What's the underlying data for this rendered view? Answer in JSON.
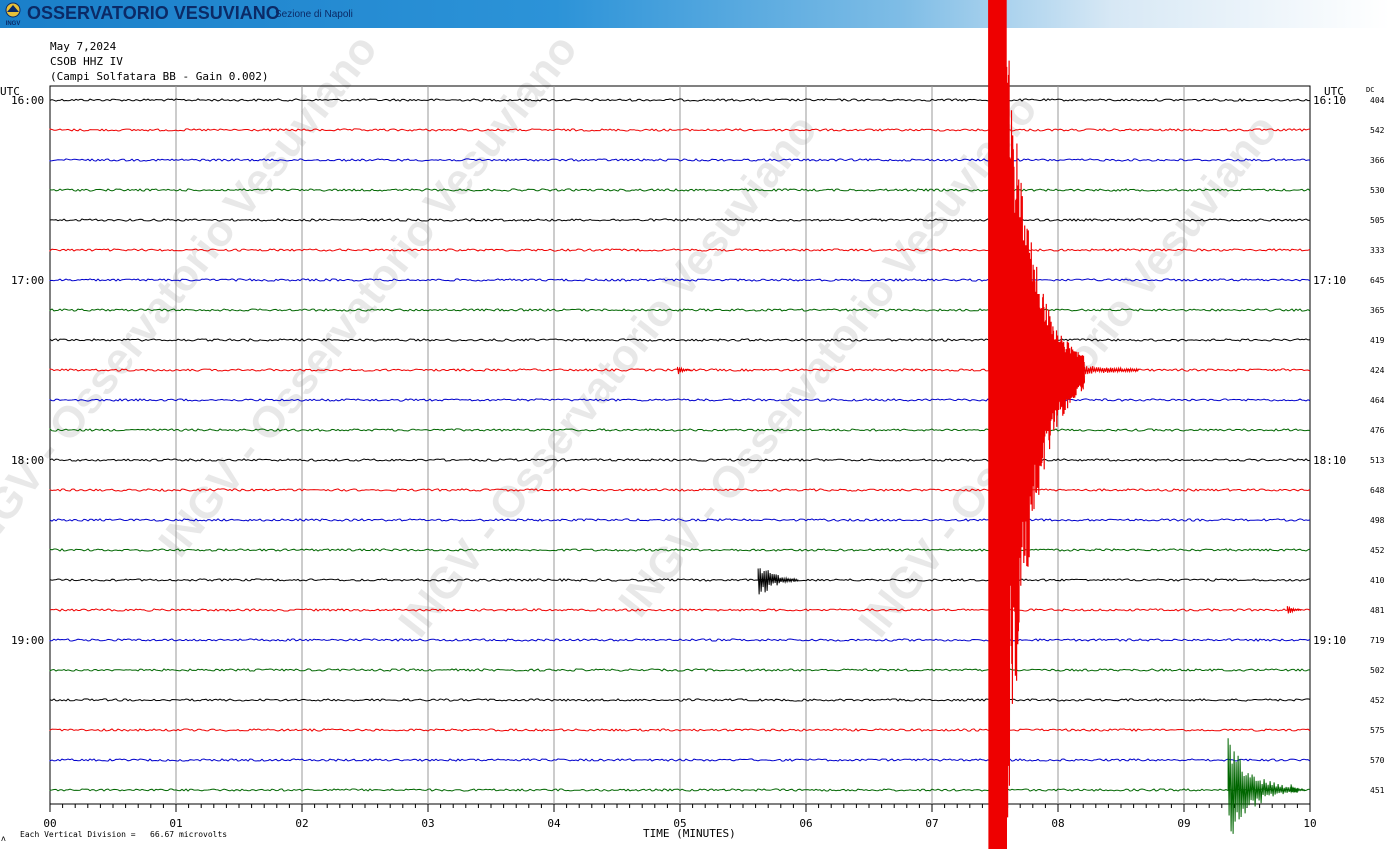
{
  "banner": {
    "title": "OSSERVATORIO VESUVIANO",
    "section": "Sezione di Napoli",
    "logo_text": "INGV"
  },
  "header": {
    "date": "May 7,2024",
    "station": "CSOB HHZ IV",
    "description": "(Campi Solfatara BB - Gain 0.002)"
  },
  "axes": {
    "left_unit": "UTC",
    "right_unit": "UTC",
    "dc_label": "DC",
    "xlabel": "TIME (MINUTES)",
    "x_ticks": [
      "00",
      "01",
      "02",
      "03",
      "04",
      "05",
      "06",
      "07",
      "08",
      "09",
      "10"
    ],
    "left_time_labels": [
      {
        "row": 0,
        "text": "16:00"
      },
      {
        "row": 6,
        "text": "17:00"
      },
      {
        "row": 12,
        "text": "18:00"
      },
      {
        "row": 18,
        "text": "19:00"
      }
    ],
    "right_time_labels": [
      {
        "row": 0,
        "text": "16:10"
      },
      {
        "row": 6,
        "text": "17:10"
      },
      {
        "row": 12,
        "text": "18:10"
      },
      {
        "row": 18,
        "text": "19:10"
      }
    ]
  },
  "footer": {
    "scale_note": "Each Vertical Division =   66.67 microvolts"
  },
  "watermark": "INGV - Osservatorio Vesuviano",
  "colors": {
    "trace_cycle": [
      "#000000",
      "#ee0000",
      "#0000cc",
      "#006600"
    ],
    "grid": "#999999"
  },
  "chart_data": {
    "type": "line",
    "title": "May 7,2024",
    "xlabel": "TIME (MINUTES)",
    "xlim": [
      0,
      10
    ],
    "traces_count": 24,
    "minutes_per_line": 10,
    "dc_offsets": [
      404,
      542,
      366,
      530,
      505,
      333,
      645,
      365,
      419,
      424,
      464,
      476,
      513,
      648,
      498,
      452,
      410,
      481,
      719,
      502,
      452,
      575,
      570,
      451
    ],
    "events": [
      {
        "row": 9,
        "minute": 4.98,
        "amplitude": "small",
        "color": "red"
      },
      {
        "row": 16,
        "minute": 5.62,
        "amplitude": "medium",
        "color": "black"
      },
      {
        "row": 17,
        "minute": 9.82,
        "amplitude": "small",
        "color": "red"
      },
      {
        "row": 9,
        "minute": 7.45,
        "amplitude": "very large",
        "color": "red",
        "note": "large earthquake, red trace clipped spanning entire panel"
      },
      {
        "row": 23,
        "minute": 9.35,
        "amplitude": "large",
        "color": "green"
      },
      {
        "row": 23,
        "minute": 9.85,
        "amplitude": "small",
        "color": "green"
      }
    ]
  }
}
